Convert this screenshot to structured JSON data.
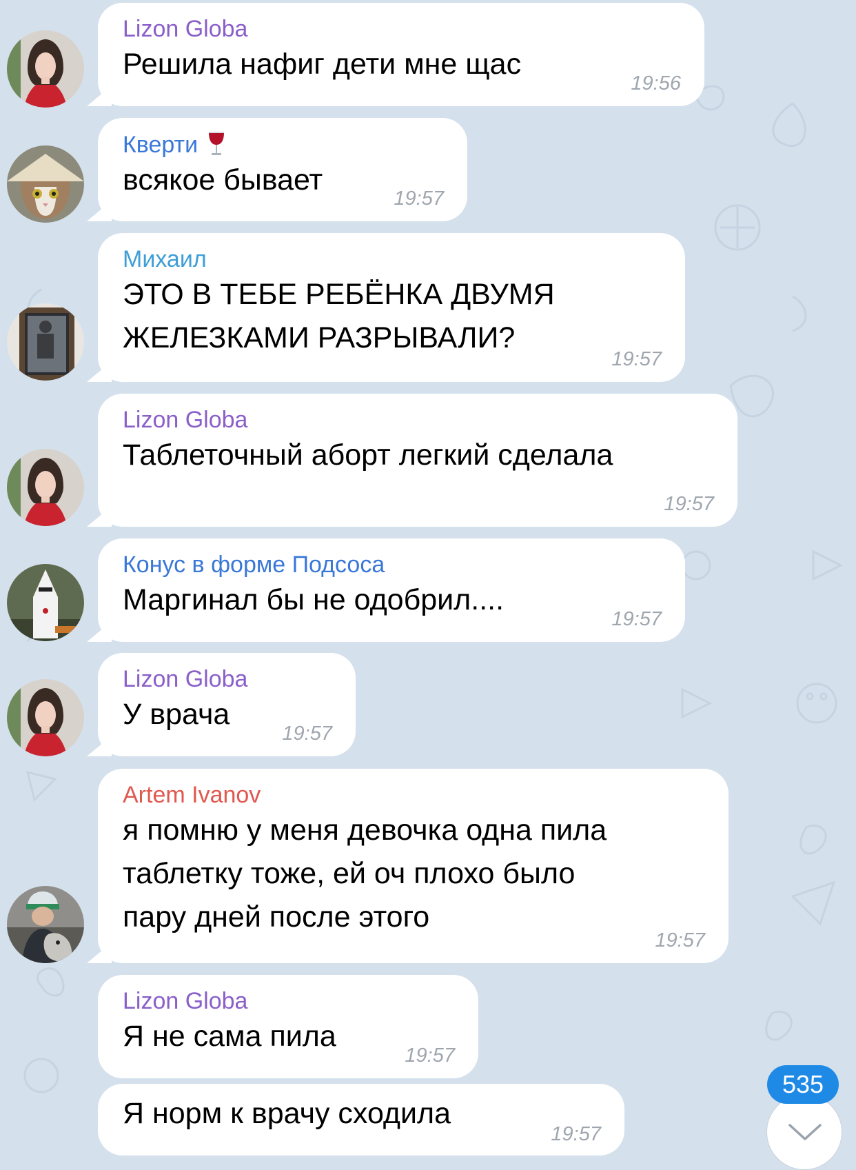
{
  "colors": {
    "background": "#d4e0ec",
    "bubble": "#ffffff",
    "timestamp": "#9fa6ae",
    "badge": "#1e8ae6"
  },
  "messages": [
    {
      "sender": "Lizon Globa",
      "sender_color": "#8a5fc9",
      "text": [
        "Решила нафиг дети мне щас"
      ],
      "time": "19:56",
      "avatar": "girl-portrait"
    },
    {
      "sender": "Кверти",
      "sender_emoji": "wine-glass-icon",
      "sender_color": "#3a78d8",
      "text": [
        "всякое бывает"
      ],
      "time": "19:57",
      "avatar": "cat-with-hat"
    },
    {
      "sender": "Михаил",
      "sender_color": "#3d9fd6",
      "text": [
        "ЭТО В ТЕБЕ РЕБЁНКА ДВУМЯ",
        "ЖЕЛЕЗКАМИ РАЗРЫВАЛИ?"
      ],
      "time": "19:57",
      "avatar": "door-window"
    },
    {
      "sender": "Lizon Globa",
      "sender_color": "#8a5fc9",
      "text": [
        "Таблеточный аборт легкий сделала"
      ],
      "time": "19:57",
      "avatar": "girl-portrait"
    },
    {
      "sender": "Конус в форме Подсоса",
      "sender_color": "#3a78d8",
      "text": [
        "Маргинал бы не одобрил...."
      ],
      "time": "19:57",
      "avatar": "hooded-figure"
    },
    {
      "sender": "Lizon Globa",
      "sender_color": "#8a5fc9",
      "text": [
        "У врача"
      ],
      "time": "19:57",
      "avatar": "girl-portrait"
    },
    {
      "sender": "Artem Ivanov",
      "sender_color": "#e0584f",
      "text": [
        "я помню у меня девочка одна пила",
        "таблетку тоже, ей оч плохо было",
        "пару дней после этого"
      ],
      "time": "19:57",
      "avatar": "man-with-dog"
    },
    {
      "sender": "Lizon Globa",
      "sender_color": "#8a5fc9",
      "text": [
        "Я не сама пила"
      ],
      "time": "19:57"
    },
    {
      "text": [
        "Я норм к врачу сходила"
      ],
      "time": "19:57"
    }
  ],
  "scroll_down": {
    "unread_count": "535",
    "icon": "chevron-down-icon"
  }
}
